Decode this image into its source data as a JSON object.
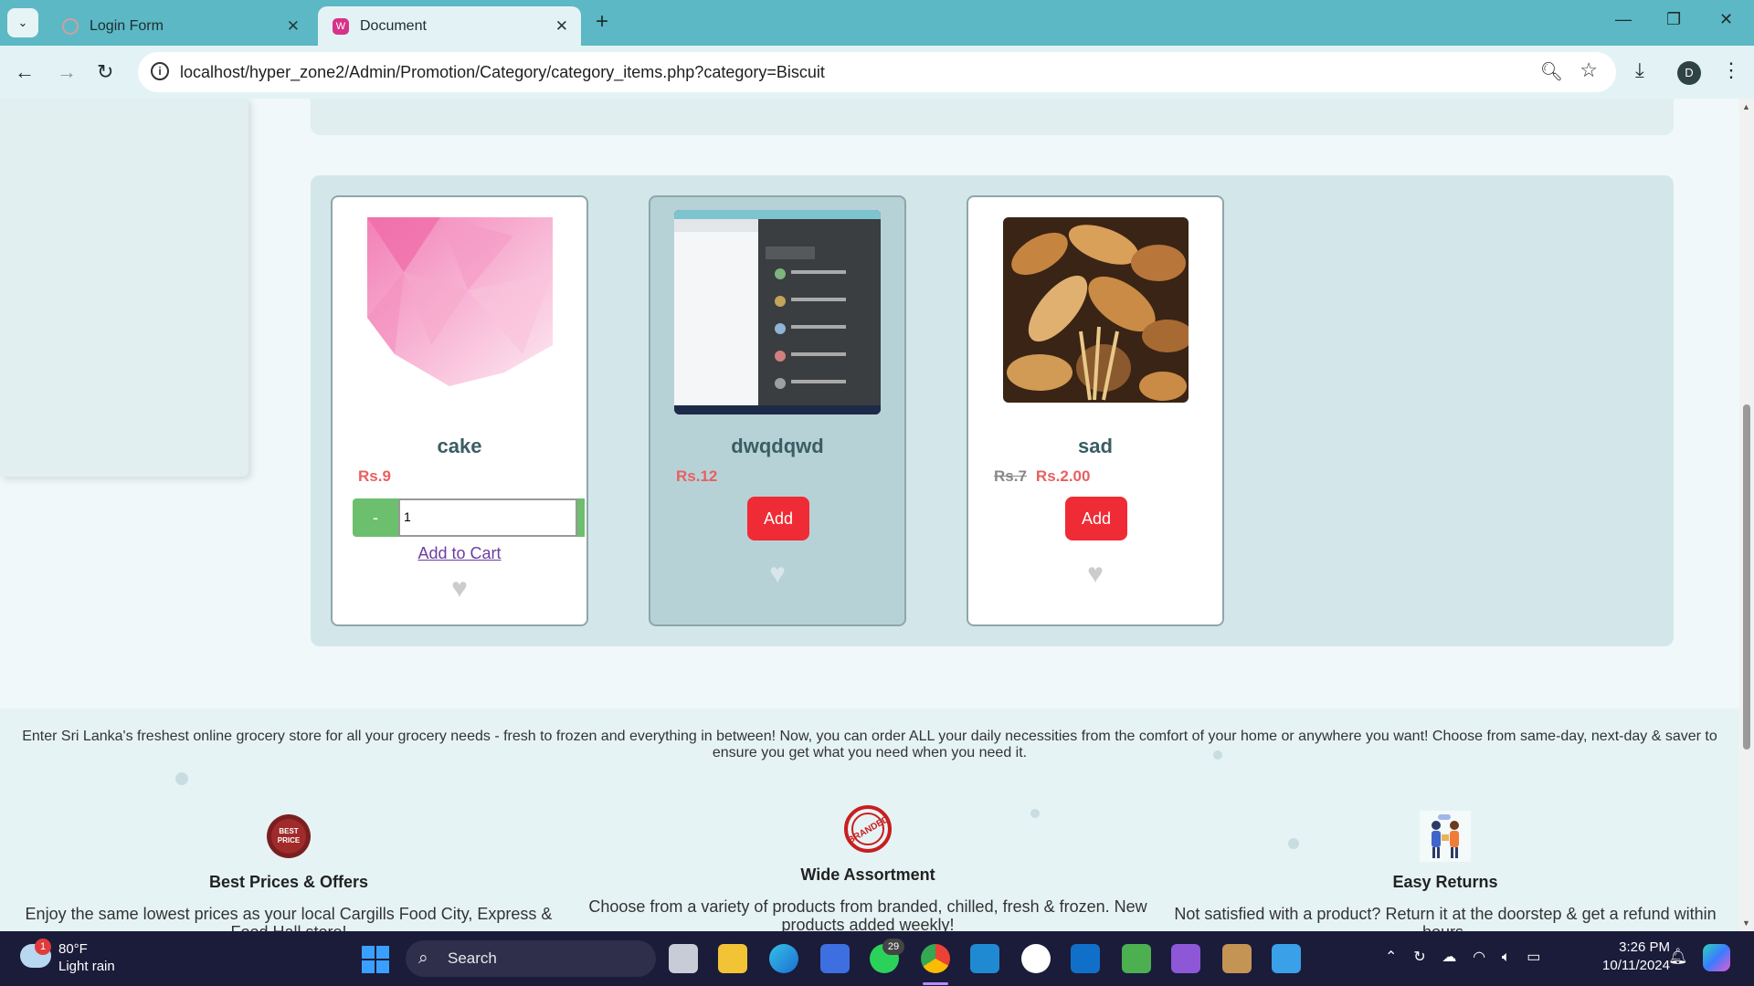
{
  "browser": {
    "tabs": [
      {
        "label": "Login Form"
      },
      {
        "label": "Document"
      }
    ],
    "url": "localhost/hyper_zone2/Admin/Promotion/Category/category_items.php?category=Biscuit",
    "profile_initial": "D"
  },
  "products": [
    {
      "name": "cake",
      "price": "Rs.9",
      "qty": "1",
      "minus_label": "-",
      "add_to_cart_label": "Add to Cart",
      "image": "pink-polygon-image"
    },
    {
      "name": "dwqdqwd",
      "price": "Rs.12",
      "add_label": "Add",
      "image": "screenshot-image"
    },
    {
      "name": "sad",
      "old_price": "Rs.7",
      "price": "Rs.2.00",
      "add_label": "Add",
      "image": "bread-image"
    }
  ],
  "footer": {
    "blurb": "Enter Sri Lanka's freshest online grocery store for all your grocery needs - fresh to frozen and everything in between! Now, you can order ALL your daily necessities from the comfort of your home or anywhere you want! Choose from same-day, next-day & saver to ensure you get what you need when you need it.",
    "features": [
      {
        "title": "Best Prices & Offers",
        "text": "Enjoy the same lowest prices as your local Cargills Food City, Express & Food Hall store!",
        "icon_text": "BEST PRICE"
      },
      {
        "title": "Wide Assortment",
        "text": "Choose from a variety of products from branded, chilled, fresh & frozen. New products added weekly!",
        "icon_text": "BRANDED"
      },
      {
        "title": "Easy Returns",
        "text": "Not satisfied with a product? Return it at the doorstep & get a refund within hours.",
        "icon_text": ""
      }
    ]
  },
  "taskbar": {
    "weather_badge": "1",
    "temperature": "80°F",
    "condition": "Light rain",
    "search_label": "Search",
    "whatsapp_count": "29",
    "time": "3:26 PM",
    "date": "10/11/2024"
  },
  "colors": {
    "accent": "#ef2b35",
    "tab_bar": "#5cb8c4",
    "taskbar": "#1b1b3a"
  }
}
